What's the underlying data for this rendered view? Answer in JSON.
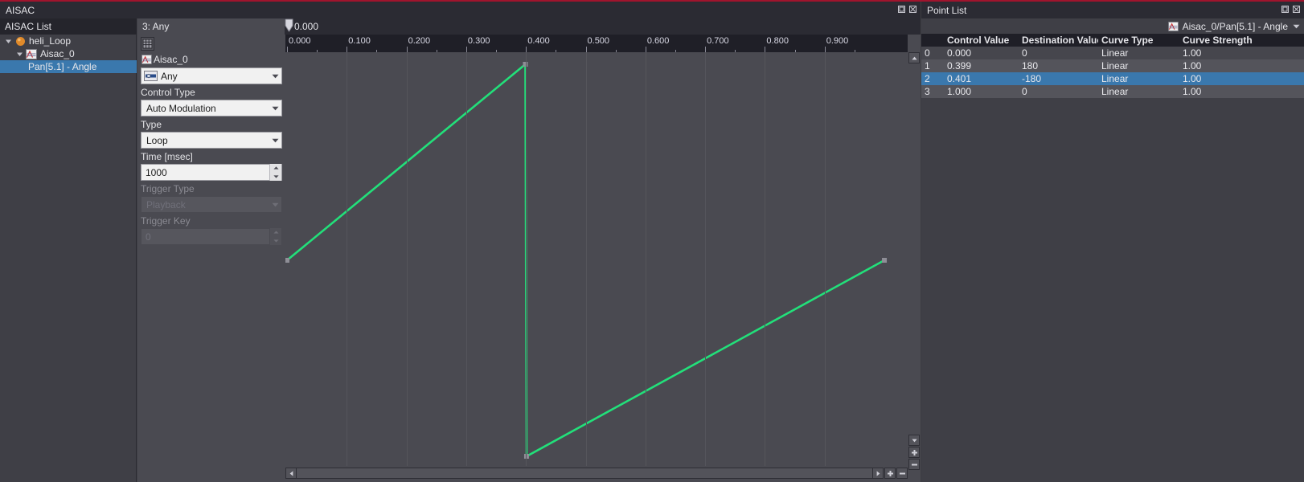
{
  "accent_color": "#a0142d",
  "curve_color": "#22e07a",
  "selection_color": "#3a78ad",
  "aisac_window": {
    "title": "AISAC",
    "window_buttons": [
      "float-icon",
      "close-icon"
    ],
    "list_pane": {
      "header": "AISAC List",
      "tree": [
        {
          "label": "heli_Loop",
          "depth": 0,
          "icon": "sphere-icon",
          "twisty": "expanded",
          "selected": false
        },
        {
          "label": "Aisac_0",
          "depth": 1,
          "icon": "aisac-graph-icon",
          "twisty": "expanded",
          "selected": false
        },
        {
          "label": "Pan[5.1] - Angle",
          "depth": 2,
          "icon": "none",
          "twisty": "none",
          "selected": true
        }
      ]
    },
    "props_pane": {
      "header": "3: Any",
      "toolbar_button": "table-icon",
      "aisac_name": "Aisac_0",
      "aisac_name_icon": "aisac-graph-icon",
      "control_combo": {
        "value": "Any",
        "icon": "control-icon",
        "enabled": true
      },
      "fields": [
        {
          "label": "Control Type",
          "type": "combo",
          "value": "Auto Modulation",
          "enabled": true
        },
        {
          "label": "Type",
          "type": "combo",
          "value": "Loop",
          "enabled": true
        },
        {
          "label": "Time [msec]",
          "type": "spin",
          "value": "1000",
          "enabled": true
        },
        {
          "label": "Trigger Type",
          "type": "combo",
          "value": "Playback",
          "enabled": false
        },
        {
          "label": "Trigger Key",
          "type": "spin",
          "value": "0",
          "enabled": false
        }
      ]
    },
    "graph": {
      "playhead_time": "0.000",
      "scroll_left_icon": "triangle-left-icon",
      "scroll_right_icon": "triangle-right-icon",
      "zoom_in_icon": "plus-icon",
      "zoom_out_icon": "minus-icon",
      "vscroll_up_icon": "triangle-up-icon",
      "vscroll_down_icon": "triangle-down-icon"
    }
  },
  "point_list_window": {
    "title": "Point List",
    "window_buttons": [
      "float-icon",
      "close-icon"
    ],
    "selector": {
      "icon": "aisac-graph-icon",
      "text": "Aisac_0/Pan[5.1] - Angle",
      "arrow": "chevron-down-icon"
    },
    "columns": [
      "",
      "Control Value",
      "Destination Value",
      "Curve Type",
      "Curve Strength"
    ],
    "rows": [
      {
        "index": "0",
        "control": "0.000",
        "destination": "0",
        "curve_type": "Linear",
        "strength": "1.00",
        "selected": false
      },
      {
        "index": "1",
        "control": "0.399",
        "destination": "180",
        "curve_type": "Linear",
        "strength": "1.00",
        "selected": false
      },
      {
        "index": "2",
        "control": "0.401",
        "destination": "-180",
        "curve_type": "Linear",
        "strength": "1.00",
        "selected": true
      },
      {
        "index": "3",
        "control": "1.000",
        "destination": "0",
        "curve_type": "Linear",
        "strength": "1.00",
        "selected": false
      }
    ]
  },
  "chart_data": {
    "type": "line",
    "title": "Aisac_0/Pan[5.1] - Angle",
    "xlabel": "Control Value",
    "ylabel": "Destination Value",
    "xlim": [
      0.0,
      1.0
    ],
    "ylim": [
      -180,
      180
    ],
    "grid": true,
    "tick_labels": [
      "0.000",
      "0.100",
      "0.200",
      "0.300",
      "0.400",
      "0.500",
      "0.600",
      "0.700",
      "0.800",
      "0.900"
    ],
    "tick_values": [
      0.0,
      0.1,
      0.2,
      0.3,
      0.4,
      0.5,
      0.6,
      0.7,
      0.8,
      0.9
    ],
    "minor_tick_step": 0.05,
    "series": [
      {
        "name": "Pan[5.1] - Angle",
        "color": "#22e07a",
        "x": [
          0.0,
          0.399,
          0.401,
          1.0
        ],
        "y": [
          0,
          180,
          -180,
          0
        ]
      }
    ]
  }
}
